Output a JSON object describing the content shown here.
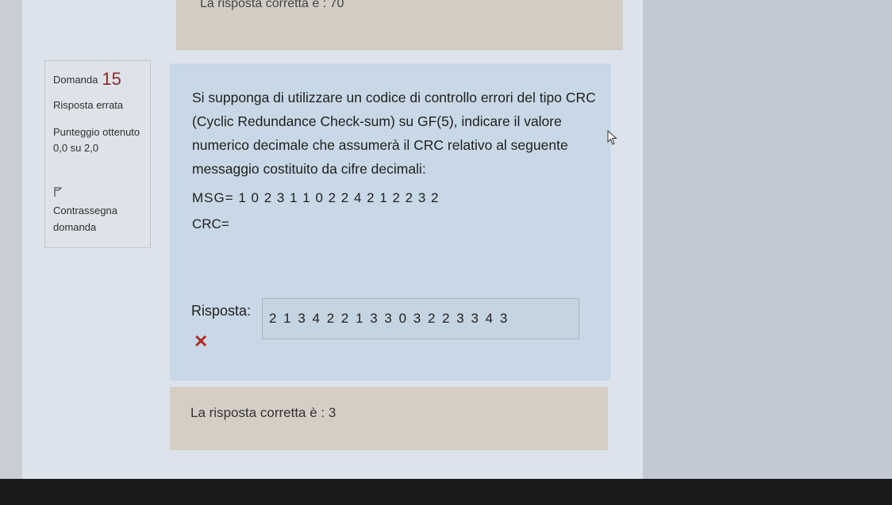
{
  "previous_question": {
    "correct_answer_text": "La risposta corretta è : 70"
  },
  "question_info": {
    "question_label": "Domanda",
    "question_number": "15",
    "status": "Risposta errata",
    "grade": "Punteggio ottenuto 0,0 su 2,0",
    "flag_label": "Contrassegna domanda",
    "flag_icon": "flag-icon"
  },
  "question": {
    "text": "Si supponga di utilizzare un codice di controllo errori del tipo CRC (Cyclic Redundance Check-sum) su GF(5), indicare il valore numerico decimale che assumerà il CRC relativo al seguente messaggio costituito da cifre decimali:",
    "msg_line": "MSG= 1 0 2 3 1 1 0 2 2 4 2 1 2 2 3 2",
    "crc_label": "CRC="
  },
  "answer": {
    "label": "Risposta:",
    "value": "2 1 3 4 2 2 1 3 3 0 3 2 2 3 3 4 3",
    "result_icon": "incorrect-x-icon",
    "result_color": "#b32b22"
  },
  "feedback": {
    "correct_answer_text": "La risposta corretta è : 3"
  },
  "colors": {
    "question_bg": "#c8d8e6",
    "feedback_bg": "#d6cec4",
    "question_number_color": "#8a2a26"
  }
}
